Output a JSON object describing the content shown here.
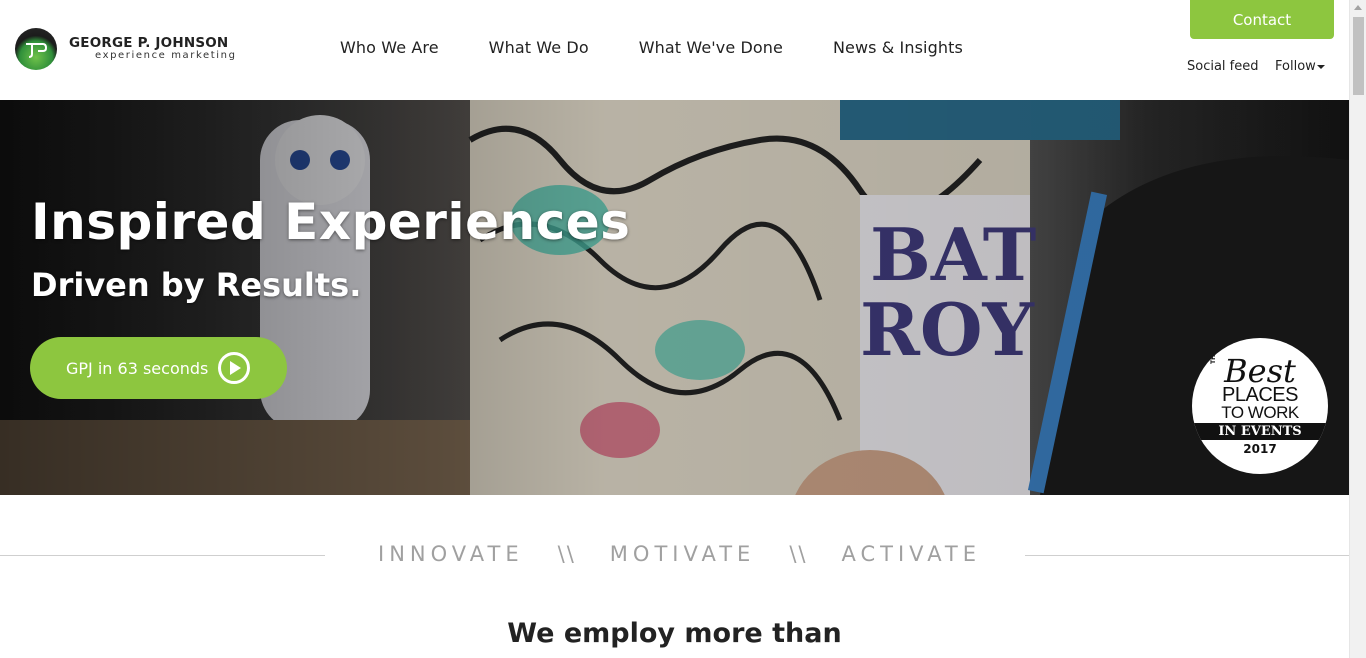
{
  "header": {
    "logo": {
      "name": "GEORGE P. JOHNSON",
      "tagline": "experience marketing",
      "icon": "gpj-logo-icon"
    },
    "nav": [
      {
        "label": "Who We Are"
      },
      {
        "label": "What We Do"
      },
      {
        "label": "What We've Done"
      },
      {
        "label": "News & Insights"
      }
    ],
    "contact_label": "Contact",
    "social_feed_label": "Social feed",
    "follow_label": "Follow"
  },
  "hero": {
    "title": "Inspired Experiences",
    "subtitle": "Driven by Results.",
    "video_button_label": "GPJ in 63 seconds",
    "video_button_icon": "play-icon",
    "badge": {
      "the": "THE",
      "best": "Best",
      "places": "PLACES",
      "to_work": "TO WORK",
      "in_events": "IN EVENTS",
      "year": "2017"
    }
  },
  "tagline": {
    "words": [
      "INNOVATE",
      "MOTIVATE",
      "ACTIVATE"
    ],
    "separator": "\\\\"
  },
  "employ_heading": "We employ more than",
  "colors": {
    "accent_green": "#8dc63f",
    "tagline_gray": "#a0a0a0",
    "text": "#222222"
  }
}
